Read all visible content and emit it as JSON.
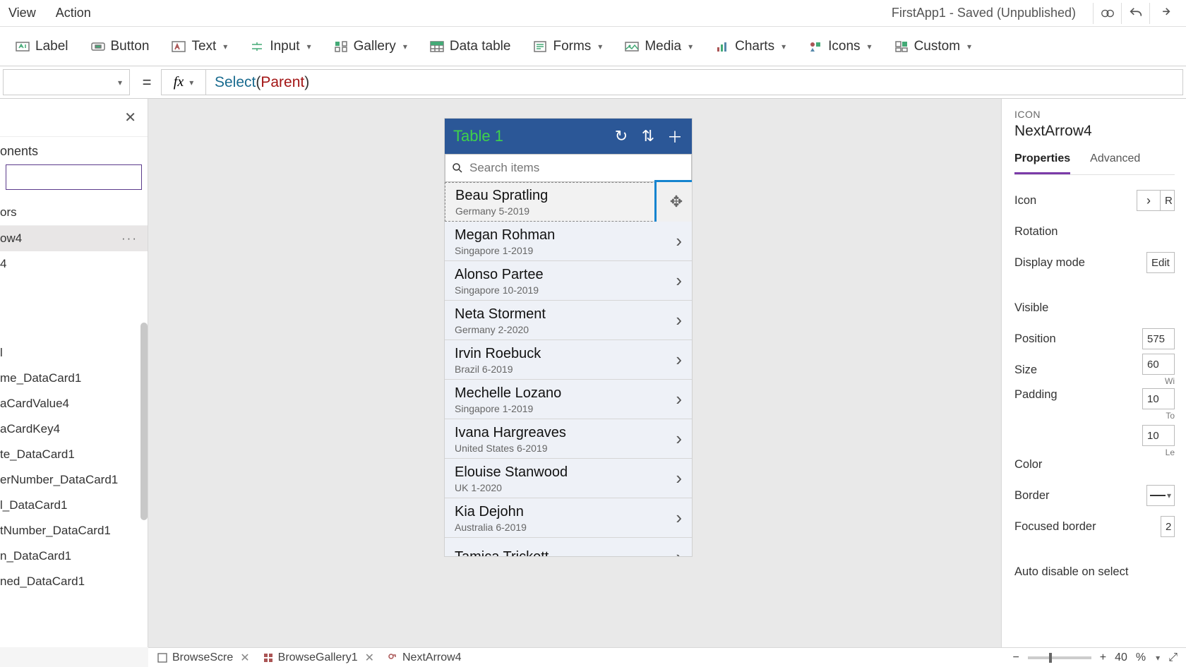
{
  "topMenu": {
    "view": "View",
    "action": "Action"
  },
  "appTitle": "FirstApp1 - Saved (Unpublished)",
  "ribbon": {
    "label": "Label",
    "button": "Button",
    "text": "Text",
    "input": "Input",
    "gallery": "Gallery",
    "dataTable": "Data table",
    "forms": "Forms",
    "media": "Media",
    "charts": "Charts",
    "icons": "Icons",
    "custom": "Custom"
  },
  "formula": {
    "fn": "Select",
    "arg": "Parent",
    "fx": "fx",
    "eq": "="
  },
  "leftPanel": {
    "tab": "onents",
    "itemPartial": "ors",
    "selected": "ow4",
    "item4": "4",
    "treeItems": [
      "l",
      "me_DataCard1",
      "aCardValue4",
      "aCardKey4",
      "te_DataCard1",
      "erNumber_DataCard1",
      "l_DataCard1",
      "tNumber_DataCard1",
      "n_DataCard1",
      "ned_DataCard1"
    ]
  },
  "phone": {
    "title": "Table 1",
    "searchPlaceholder": "Search items",
    "items": [
      {
        "name": "Beau Spratling",
        "sub": "Germany 5-2019"
      },
      {
        "name": "Megan Rohman",
        "sub": "Singapore 1-2019"
      },
      {
        "name": "Alonso Partee",
        "sub": "Singapore 10-2019"
      },
      {
        "name": "Neta Storment",
        "sub": "Germany 2-2020"
      },
      {
        "name": "Irvin Roebuck",
        "sub": "Brazil 6-2019"
      },
      {
        "name": "Mechelle Lozano",
        "sub": "Singapore 1-2019"
      },
      {
        "name": "Ivana Hargreaves",
        "sub": "United States 6-2019"
      },
      {
        "name": "Elouise Stanwood",
        "sub": "UK 1-2020"
      },
      {
        "name": "Kia Dejohn",
        "sub": "Australia 6-2019"
      },
      {
        "name": "Tamica Trickett",
        "sub": ""
      }
    ]
  },
  "rightPanel": {
    "kind": "ICON",
    "name": "NextArrow4",
    "tabProps": "Properties",
    "tabAdv": "Advanced",
    "labels": {
      "icon": "Icon",
      "rotation": "Rotation",
      "displayMode": "Display mode",
      "visible": "Visible",
      "position": "Position",
      "size": "Size",
      "padding": "Padding",
      "color": "Color",
      "border": "Border",
      "focusedBorder": "Focused border",
      "autoDisable": "Auto disable on select"
    },
    "values": {
      "iconVal": "R",
      "displayMode": "Edit",
      "posX": "575",
      "sizeW": "60",
      "sizeWLabel": "Wi",
      "padT": "10",
      "padTLabel": "To",
      "padL": "10",
      "padLLabel": "Le",
      "focusedBorder": "2"
    }
  },
  "statusBar": {
    "screen": "BrowseScre",
    "gallery": "BrowseGallery1",
    "control": "NextArrow4",
    "zoom": "40",
    "pct": "%"
  }
}
